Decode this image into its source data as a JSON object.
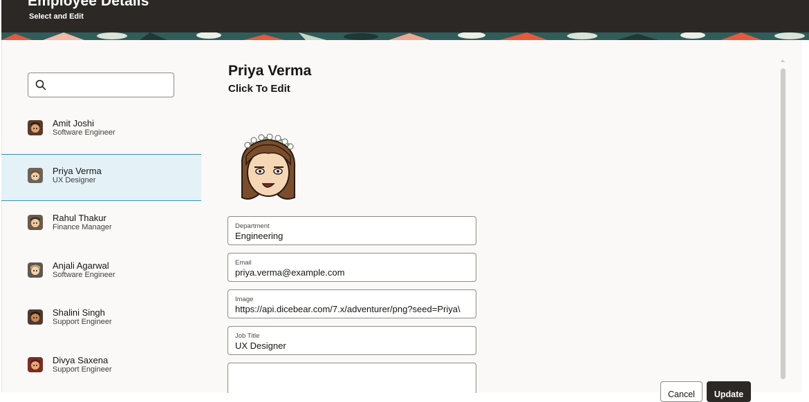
{
  "header": {
    "title": "Employee Details",
    "subtitle": "Select and Edit"
  },
  "search": {
    "placeholder": "",
    "value": ""
  },
  "employees": [
    {
      "name": "Amit Joshi",
      "role": "Software Engineer"
    },
    {
      "name": "Priya Verma",
      "role": "UX Designer"
    },
    {
      "name": "Rahul Thakur",
      "role": "Finance Manager"
    },
    {
      "name": "Anjali Agarwal",
      "role": "Software Engineer"
    },
    {
      "name": "Shalini Singh",
      "role": "Support Engineer"
    },
    {
      "name": "Divya Saxena",
      "role": "Support Engineer"
    }
  ],
  "selected_index": 1,
  "detail": {
    "name": "Priya Verma",
    "subtitle": "Click To Edit",
    "fields": [
      {
        "label": "Department",
        "value": "Engineering"
      },
      {
        "label": "Email",
        "value": "priya.verma@example.com"
      },
      {
        "label": "Image",
        "value": "https://api.dicebear.com/7.x/adventurer/png?seed=Priya\\"
      },
      {
        "label": "Job Title",
        "value": "UX Designer"
      }
    ]
  },
  "actions": {
    "cancel_label": "Cancel",
    "update_label": "Update"
  },
  "colors": {
    "header_bg": "#2b2826",
    "selected_bg": "#e4f1f7",
    "selected_border": "#3b8fb5",
    "primary_button": "#2b2826"
  }
}
